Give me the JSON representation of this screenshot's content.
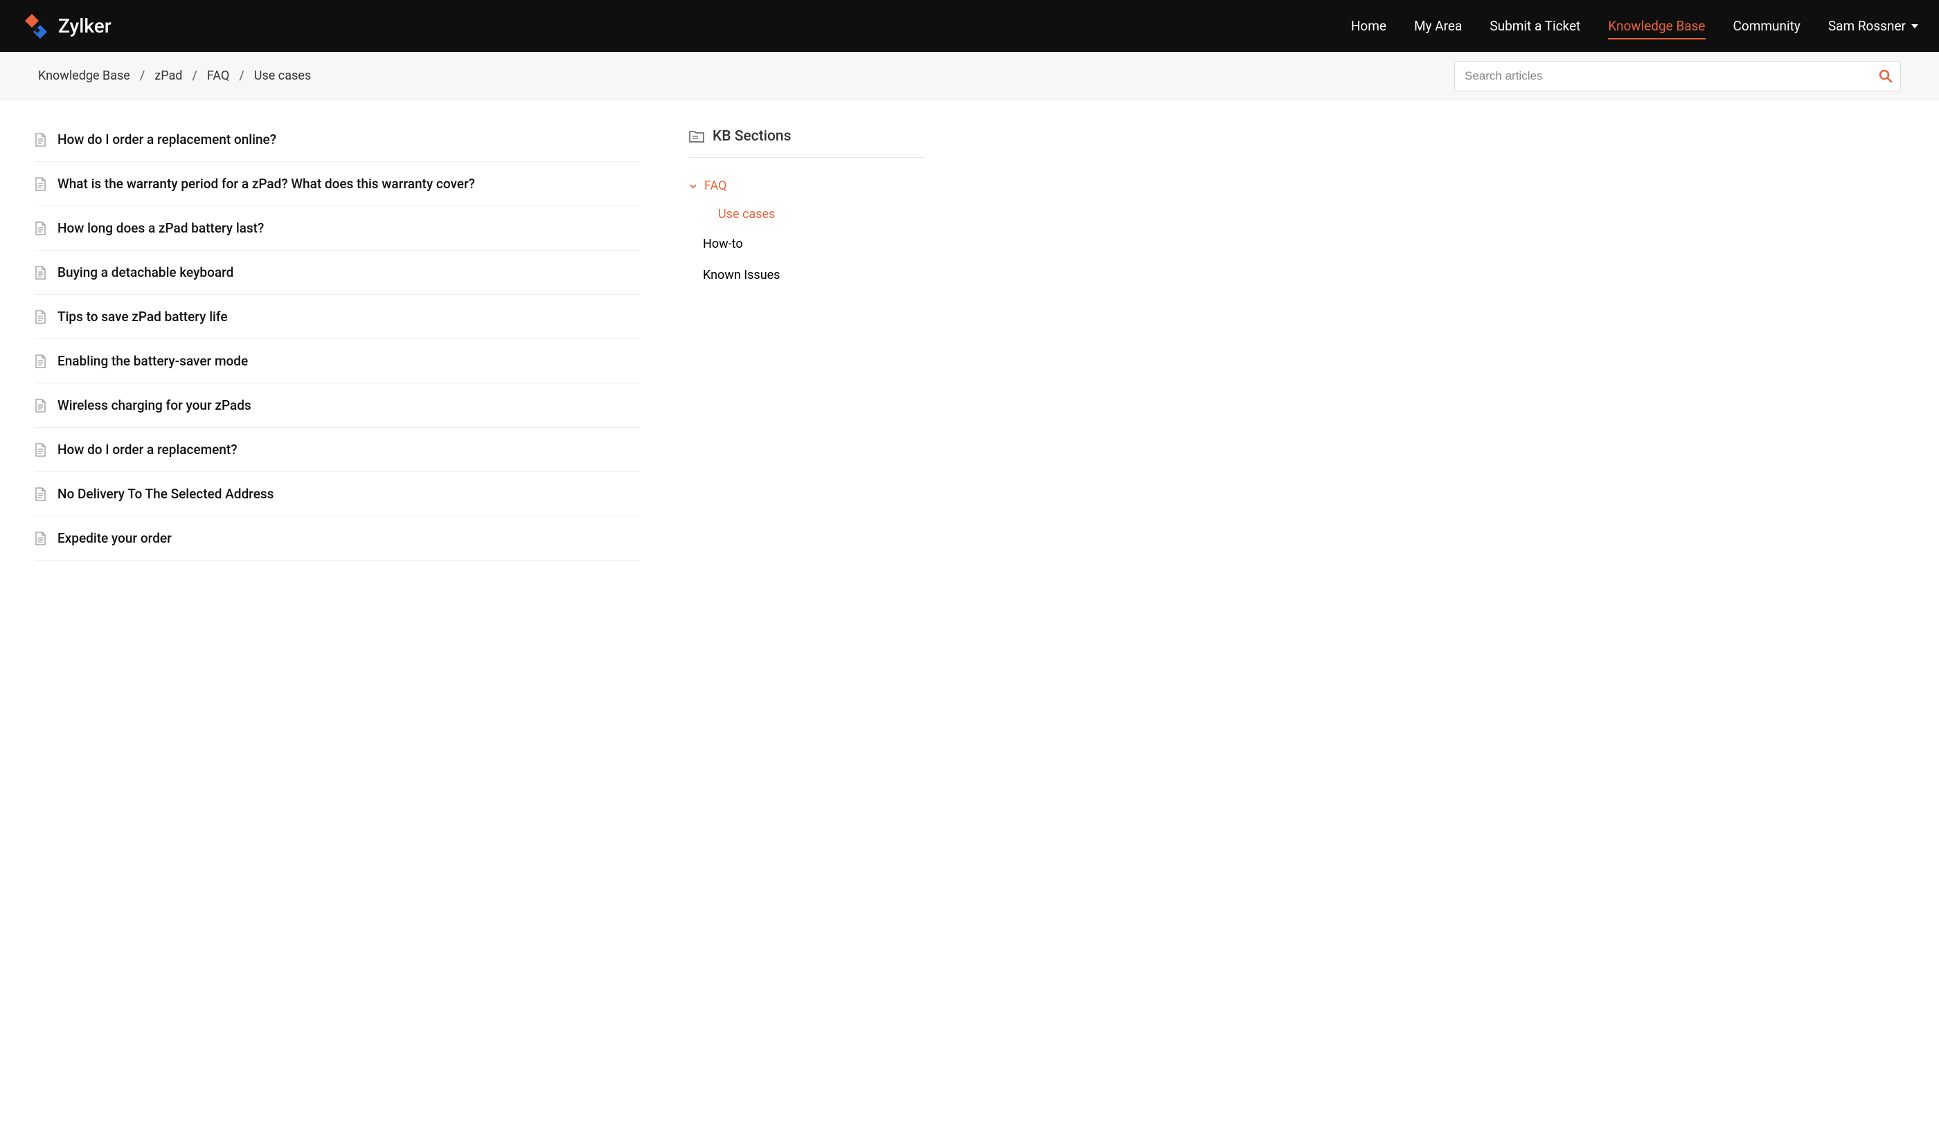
{
  "brand": {
    "name": "Zylker"
  },
  "nav": {
    "items": [
      {
        "label": "Home",
        "active": false
      },
      {
        "label": "My Area",
        "active": false
      },
      {
        "label": "Submit a Ticket",
        "active": false
      },
      {
        "label": "Knowledge Base",
        "active": true
      },
      {
        "label": "Community",
        "active": false
      }
    ],
    "user": "Sam Rossner"
  },
  "breadcrumb": {
    "items": [
      "Knowledge Base",
      "zPad",
      "FAQ",
      "Use cases"
    ]
  },
  "search": {
    "placeholder": "Search articles"
  },
  "articles": [
    {
      "title": "How do I order a replacement online?"
    },
    {
      "title": "What is the warranty period for a zPad? What does this warranty cover?"
    },
    {
      "title": "How long does a zPad battery last?"
    },
    {
      "title": "Buying a detachable keyboard"
    },
    {
      "title": "Tips to save zPad battery life"
    },
    {
      "title": "Enabling the battery-saver mode"
    },
    {
      "title": "Wireless charging for your zPads"
    },
    {
      "title": "How do I order a replacement?"
    },
    {
      "title": "No Delivery To The Selected Address"
    },
    {
      "title": "Expedite your order"
    }
  ],
  "sidebar": {
    "title": "KB Sections",
    "tree": [
      {
        "label": "FAQ",
        "level": 0,
        "expanded": true,
        "active": true,
        "hasChevron": true
      },
      {
        "label": "Use cases",
        "level": 1,
        "active": true,
        "hasChevron": false
      },
      {
        "label": "How-to",
        "level": 0,
        "active": false,
        "hasChevron": false,
        "plain": true
      },
      {
        "label": "Known Issues",
        "level": 0,
        "active": false,
        "hasChevron": false,
        "plain": true
      }
    ]
  }
}
